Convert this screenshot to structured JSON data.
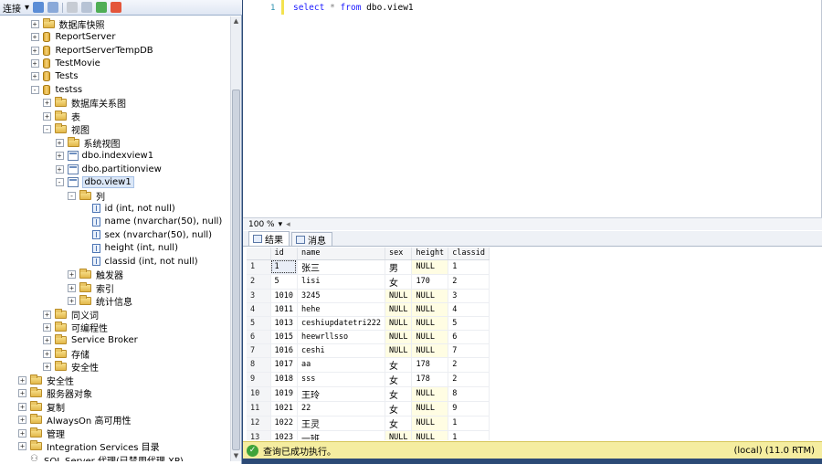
{
  "explorer": {
    "toolbar": {
      "connect_label": "连接"
    },
    "tree": [
      {
        "label": "数据库快照",
        "icon": "folder-icon",
        "level": 2,
        "expander": "+"
      },
      {
        "label": "ReportServer",
        "icon": "database-icon",
        "level": 2,
        "expander": "+"
      },
      {
        "label": "ReportServerTempDB",
        "icon": "database-icon",
        "level": 2,
        "expander": "+"
      },
      {
        "label": "TestMovie",
        "icon": "database-icon",
        "level": 2,
        "expander": "+"
      },
      {
        "label": "Tests",
        "icon": "database-icon",
        "level": 2,
        "expander": "+"
      },
      {
        "label": "testss",
        "icon": "database-icon",
        "level": 2,
        "expander": "-"
      },
      {
        "label": "数据库关系图",
        "icon": "folder-icon",
        "level": 3,
        "expander": "+"
      },
      {
        "label": "表",
        "icon": "folder-icon",
        "level": 3,
        "expander": "+"
      },
      {
        "label": "视图",
        "icon": "folder-icon",
        "level": 3,
        "expander": "-"
      },
      {
        "label": "系统视图",
        "icon": "folder-icon",
        "level": 4,
        "expander": "+"
      },
      {
        "label": "dbo.indexview1",
        "icon": "view-icon",
        "level": 4,
        "expander": "+"
      },
      {
        "label": "dbo.partitionview",
        "icon": "view-icon",
        "level": 4,
        "expander": "+"
      },
      {
        "label": "dbo.view1",
        "icon": "view-icon",
        "level": 4,
        "expander": "-",
        "selected": true
      },
      {
        "label": "列",
        "icon": "folder-icon",
        "level": 5,
        "expander": "-"
      },
      {
        "label": "id (int, not null)",
        "icon": "column-icon",
        "level": 6,
        "expander": ""
      },
      {
        "label": "name (nvarchar(50), null)",
        "icon": "column-icon",
        "level": 6,
        "expander": ""
      },
      {
        "label": "sex (nvarchar(50), null)",
        "icon": "column-icon",
        "level": 6,
        "expander": ""
      },
      {
        "label": "height (int, null)",
        "icon": "column-icon",
        "level": 6,
        "expander": ""
      },
      {
        "label": "classid (int, not null)",
        "icon": "column-icon",
        "level": 6,
        "expander": ""
      },
      {
        "label": "触发器",
        "icon": "folder-icon",
        "level": 5,
        "expander": "+"
      },
      {
        "label": "索引",
        "icon": "folder-icon",
        "level": 5,
        "expander": "+"
      },
      {
        "label": "统计信息",
        "icon": "folder-icon",
        "level": 5,
        "expander": "+"
      },
      {
        "label": "同义词",
        "icon": "folder-icon",
        "level": 3,
        "expander": "+"
      },
      {
        "label": "可编程性",
        "icon": "folder-icon",
        "level": 3,
        "expander": "+"
      },
      {
        "label": "Service Broker",
        "icon": "folder-icon",
        "level": 3,
        "expander": "+"
      },
      {
        "label": "存储",
        "icon": "folder-icon",
        "level": 3,
        "expander": "+"
      },
      {
        "label": "安全性",
        "icon": "folder-icon",
        "level": 3,
        "expander": "+"
      },
      {
        "label": "安全性",
        "icon": "folder-icon",
        "level": 1,
        "expander": "+"
      },
      {
        "label": "服务器对象",
        "icon": "folder-icon",
        "level": 1,
        "expander": "+"
      },
      {
        "label": "复制",
        "icon": "folder-icon",
        "level": 1,
        "expander": "+"
      },
      {
        "label": "AlwaysOn 高可用性",
        "icon": "folder-icon",
        "level": 1,
        "expander": "+"
      },
      {
        "label": "管理",
        "icon": "folder-icon",
        "level": 1,
        "expander": "+"
      },
      {
        "label": "Integration Services 目录",
        "icon": "folder-icon",
        "level": 1,
        "expander": "+"
      },
      {
        "label": "SQL Server 代理(已禁用代理 XP)",
        "icon": "agent-icon",
        "level": 1,
        "expander": ""
      }
    ]
  },
  "editor": {
    "line_number": "1",
    "query": {
      "kw_select": "select",
      "star": "*",
      "kw_from": "from",
      "object": "dbo.view1"
    }
  },
  "zoom": {
    "level": "100 %"
  },
  "tabs": [
    {
      "label": "结果",
      "icon": "results-grid-icon",
      "active": true
    },
    {
      "label": "消息",
      "icon": "messages-icon",
      "active": false
    }
  ],
  "grid": {
    "columns": [
      "id",
      "name",
      "sex",
      "height",
      "classid"
    ],
    "rows": [
      [
        "1",
        "1",
        "张三",
        "男",
        "NULL",
        "1"
      ],
      [
        "2",
        "5",
        "lisi",
        "女",
        "170",
        "2"
      ],
      [
        "3",
        "1010",
        "3245",
        "NULL",
        "NULL",
        "3"
      ],
      [
        "4",
        "1011",
        "hehe",
        "NULL",
        "NULL",
        "4"
      ],
      [
        "5",
        "1013",
        "ceshiupdatetri222",
        "NULL",
        "NULL",
        "5"
      ],
      [
        "6",
        "1015",
        "heewrllsso",
        "NULL",
        "NULL",
        "6"
      ],
      [
        "7",
        "1016",
        "ceshi",
        "NULL",
        "NULL",
        "7"
      ],
      [
        "8",
        "1017",
        "aa",
        "女",
        "178",
        "2"
      ],
      [
        "9",
        "1018",
        "sss",
        "女",
        "178",
        "2"
      ],
      [
        "10",
        "1019",
        "王玲",
        "女",
        "NULL",
        "8"
      ],
      [
        "11",
        "1021",
        "22",
        "女",
        "NULL",
        "9"
      ],
      [
        "12",
        "1022",
        "王灵",
        "女",
        "NULL",
        "1"
      ],
      [
        "13",
        "1023",
        "一班",
        "NULL",
        "NULL",
        "1"
      ]
    ]
  },
  "status": {
    "message": "查询已成功执行。",
    "server": "(local) (11.0 RTM)"
  },
  "colors": {
    "status_bg": "#f5eda0",
    "null_bg": "#fffde3",
    "keyword": "#1a19ff",
    "frame": "#2c4a76"
  }
}
